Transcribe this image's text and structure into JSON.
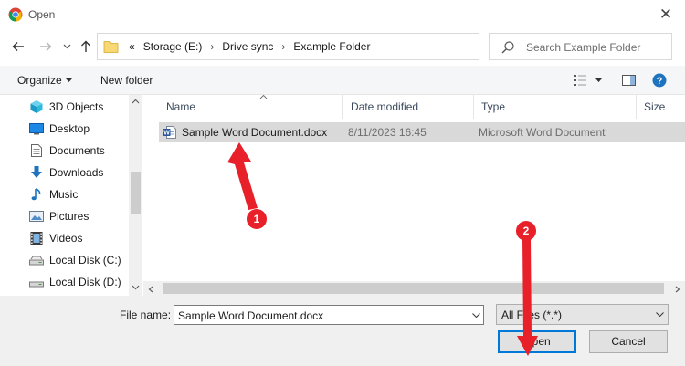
{
  "window": {
    "title": "Open"
  },
  "address": {
    "overflow_glyph": "«",
    "crumbs": [
      "Storage (E:)",
      "Drive sync",
      "Example Folder"
    ]
  },
  "search": {
    "placeholder": "Search Example Folder"
  },
  "toolbar": {
    "organize_label": "Organize",
    "new_folder_label": "New folder"
  },
  "sidebar": {
    "items": [
      {
        "label": "3D Objects",
        "icon": "cube-icon"
      },
      {
        "label": "Desktop",
        "icon": "desktop-icon"
      },
      {
        "label": "Documents",
        "icon": "documents-icon"
      },
      {
        "label": "Downloads",
        "icon": "download-arrow-icon"
      },
      {
        "label": "Music",
        "icon": "music-note-icon"
      },
      {
        "label": "Pictures",
        "icon": "pictures-icon"
      },
      {
        "label": "Videos",
        "icon": "film-icon"
      },
      {
        "label": "Local Disk (C:)",
        "icon": "drive-icon"
      },
      {
        "label": "Local Disk (D:)",
        "icon": "drive-icon"
      }
    ]
  },
  "columns": {
    "name": "Name",
    "date": "Date modified",
    "type": "Type",
    "size": "Size"
  },
  "files": [
    {
      "name": "Sample Word Document.docx",
      "date": "8/11/2023 16:45",
      "type": "Microsoft Word Document"
    }
  ],
  "footer": {
    "file_name_label": "File name:",
    "file_name_value": "Sample Word Document.docx",
    "file_type_value": "All Files (*.*)",
    "open_label": "Open",
    "cancel_label": "Cancel"
  },
  "annotations": {
    "badge_1": "1",
    "badge_2": "2"
  },
  "colors": {
    "annotation_red": "#e8202a",
    "selection": "#d9d9d9",
    "accent": "#0078d7"
  }
}
